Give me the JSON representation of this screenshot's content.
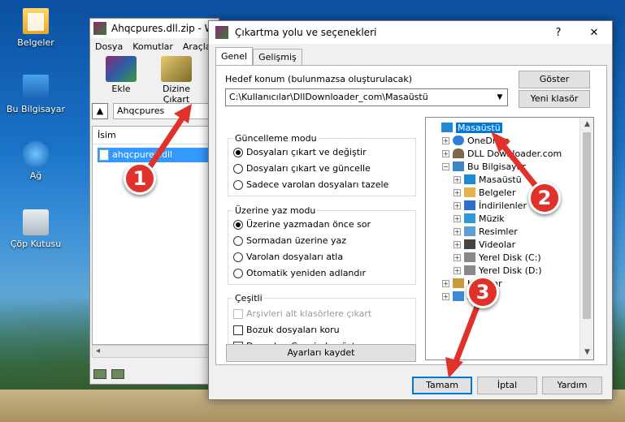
{
  "desktop": {
    "icons": [
      {
        "label": "Belgeler",
        "icon": "documents-folder-icon"
      },
      {
        "label": "Bu Bilgisayar",
        "icon": "this-pc-icon"
      },
      {
        "label": "Ağ",
        "icon": "network-icon"
      },
      {
        "label": "Çöp Kutusu",
        "icon": "recycle-bin-icon"
      }
    ]
  },
  "rar": {
    "title": "Ahqcpures.dll.zip - W",
    "menu": [
      "Dosya",
      "Komutlar",
      "Araçla"
    ],
    "tools": {
      "add": "Ekle",
      "extract": "Dizine Çıkart"
    },
    "path": "Ahqcpures",
    "list_header": "İsim",
    "selected_file": "ahqcpures.dll"
  },
  "dialog": {
    "title": "Çıkartma yolu ve seçenekleri",
    "help": "?",
    "close": "✕",
    "tabs": [
      "Genel",
      "Gelişmiş"
    ],
    "dest_label": "Hedef konum (bulunmazsa oluşturulacak)",
    "dest_value": "C:\\Kullanıcılar\\DllDownloader_com\\Masaüstü",
    "show_button": "Göster",
    "new_folder_button": "Yeni klasör",
    "update_mode": {
      "title": "Güncelleme modu",
      "options": [
        "Dosyaları çıkart ve değiştir",
        "Dosyaları çıkart ve güncelle",
        "Sadece varolan dosyaları tazele"
      ],
      "selected": 0
    },
    "overwrite_mode": {
      "title": "Üzerine yaz modu",
      "options": [
        "Üzerine yazmadan önce sor",
        "Sormadan üzerine yaz",
        "Varolan dosyaları atla",
        "Otomatik yeniden adlandır"
      ],
      "selected": 0
    },
    "misc": {
      "title": "Çeşitli",
      "options": [
        "Arşivleri alt klasörlere çıkart",
        "Bozuk dosyaları koru",
        "Dosyaları Gezginde göster"
      ]
    },
    "save_settings": "Ayarları kaydet",
    "tree": [
      {
        "label": "Masaüstü",
        "icon": "desktop-icon",
        "color": "c-desk",
        "level": 0,
        "exp": "",
        "selected": true
      },
      {
        "label": "OneDrive",
        "icon": "onedrive-icon",
        "color": "c-cloud",
        "level": 1,
        "exp": "+"
      },
      {
        "label": "DLL Downloader.com",
        "icon": "user-icon",
        "color": "c-user",
        "level": 1,
        "exp": "+"
      },
      {
        "label": "Bu Bilgisayar",
        "icon": "this-pc-icon",
        "color": "c-pc",
        "level": 1,
        "exp": "−"
      },
      {
        "label": "Masaüstü",
        "icon": "desktop-icon",
        "color": "c-desk",
        "level": 2,
        "exp": "+"
      },
      {
        "label": "Belgeler",
        "icon": "folder-icon",
        "color": "c-folder",
        "level": 2,
        "exp": "+"
      },
      {
        "label": "İndirilenler",
        "icon": "downloads-icon",
        "color": "c-down",
        "level": 2,
        "exp": "+"
      },
      {
        "label": "Müzik",
        "icon": "music-icon",
        "color": "c-music",
        "level": 2,
        "exp": "+"
      },
      {
        "label": "Resimler",
        "icon": "pictures-icon",
        "color": "c-pic",
        "level": 2,
        "exp": "+"
      },
      {
        "label": "Videolar",
        "icon": "videos-icon",
        "color": "c-vid",
        "level": 2,
        "exp": "+"
      },
      {
        "label": "Yerel Disk (C:)",
        "icon": "disk-icon",
        "color": "c-disk",
        "level": 2,
        "exp": "+"
      },
      {
        "label": "Yerel Disk (D:)",
        "icon": "disk-icon",
        "color": "c-disk",
        "level": 2,
        "exp": "+"
      },
      {
        "label": "Kitaplar",
        "icon": "libraries-icon",
        "color": "c-lib",
        "level": 1,
        "exp": "+"
      },
      {
        "label": "Ağ",
        "icon": "network-icon",
        "color": "c-net",
        "level": 1,
        "exp": "+"
      }
    ],
    "ok": "Tamam",
    "cancel": "İptal",
    "help_button": "Yardım"
  },
  "annotations": {
    "badges": [
      "1",
      "2",
      "3"
    ],
    "color": "#e0312b"
  }
}
